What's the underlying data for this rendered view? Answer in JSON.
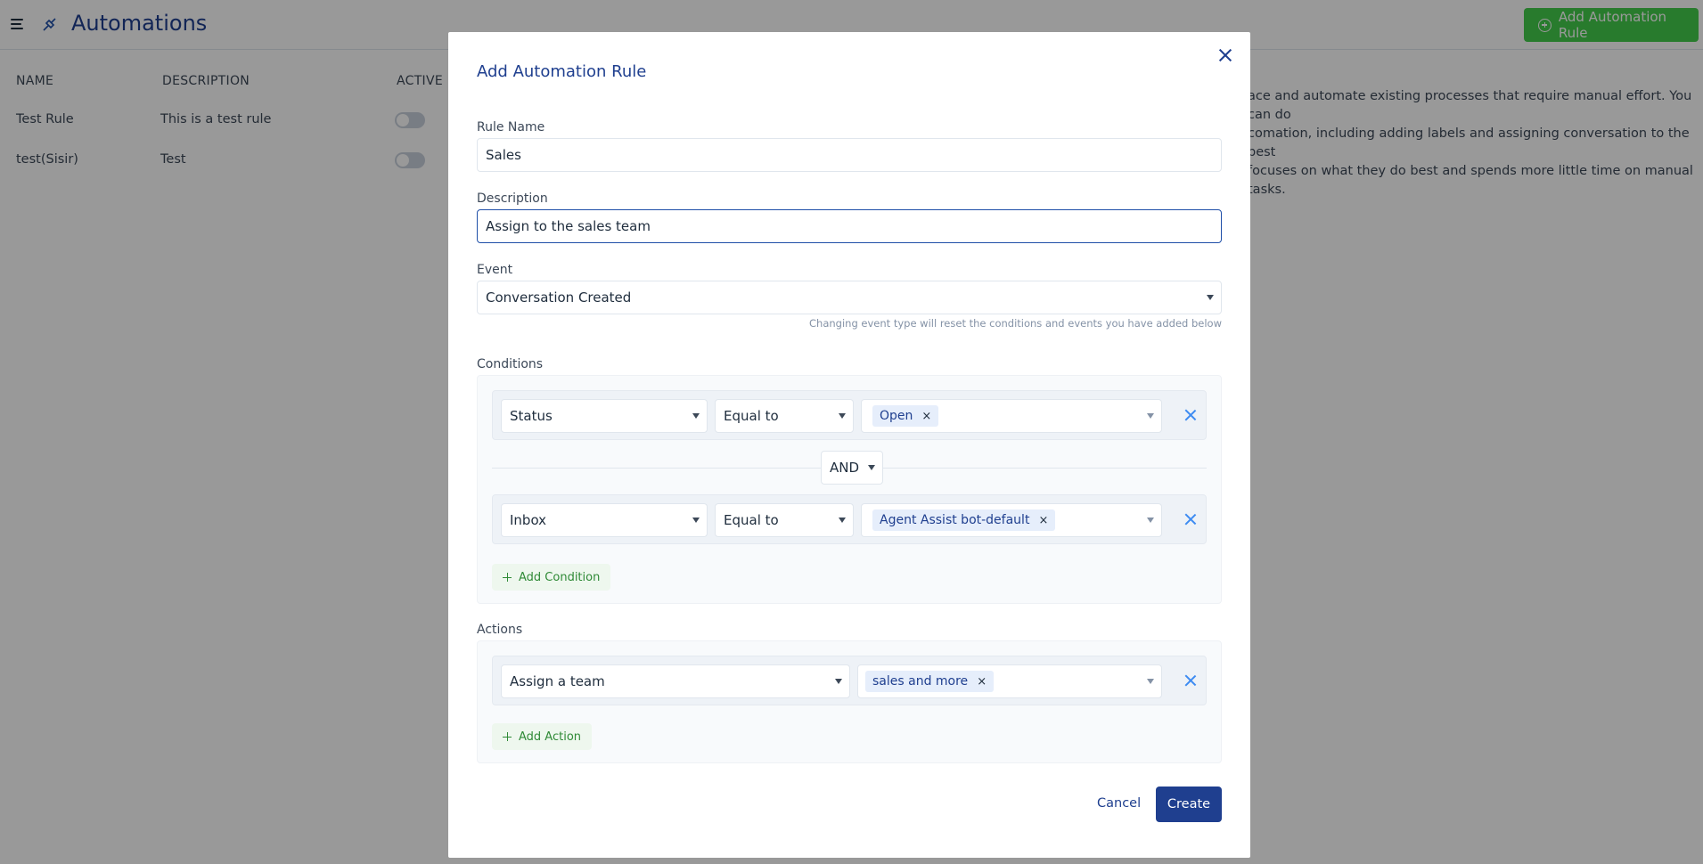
{
  "app": {
    "title": "Automations",
    "add_button_label": "Add Automation Rule"
  },
  "table": {
    "headers": [
      "NAME",
      "DESCRIPTION",
      "ACTIVE"
    ],
    "rows": [
      {
        "name": "Test Rule",
        "description": "This is a test rule",
        "active": false
      },
      {
        "name": "test(Sisir)",
        "description": "Test",
        "active": false
      }
    ]
  },
  "help_text": "ace and automate existing processes that require manual effort. You can do comation, including adding labels and assigning conversation to the best focuses on what they do best and spends more little time on manual tasks.",
  "help_lines": [
    "ace and automate existing processes that require manual effort. You can do",
    "comation, including adding labels and assigning conversation to the best",
    "focuses on what they do best and spends more little time on manual tasks."
  ],
  "modal": {
    "title": "Add Automation Rule",
    "rule_name": {
      "label": "Rule Name",
      "value": "Sales"
    },
    "description": {
      "label": "Description",
      "value": "Assign to the sales team"
    },
    "event": {
      "label": "Event",
      "value": "Conversation Created",
      "hint": "Changing event type will reset the conditions and events you have added below"
    },
    "conditions": {
      "label": "Conditions",
      "rows": [
        {
          "attribute": "Status",
          "operator": "Equal to",
          "values": [
            "Open"
          ]
        },
        {
          "attribute": "Inbox",
          "operator": "Equal to",
          "values": [
            "Agent Assist bot-default"
          ]
        }
      ],
      "query_operator": "AND",
      "add_label": "Add Condition"
    },
    "actions": {
      "label": "Actions",
      "rows": [
        {
          "action": "Assign a team",
          "values": [
            "sales and more"
          ]
        }
      ],
      "add_label": "Add Action"
    },
    "cancel_label": "Cancel",
    "create_label": "Create"
  },
  "colors": {
    "primary": "#1f3f8f",
    "success": "#44ce4b",
    "overlay": "rgba(0,0,0,0.4)",
    "remove_icon": "#3d8bf2"
  },
  "icons": {
    "menu": "hamburger-icon",
    "automation": "automation-icon",
    "close": "close-icon",
    "dropdown": "chevron-down-icon",
    "remove": "close-icon",
    "add": "plus-icon"
  }
}
